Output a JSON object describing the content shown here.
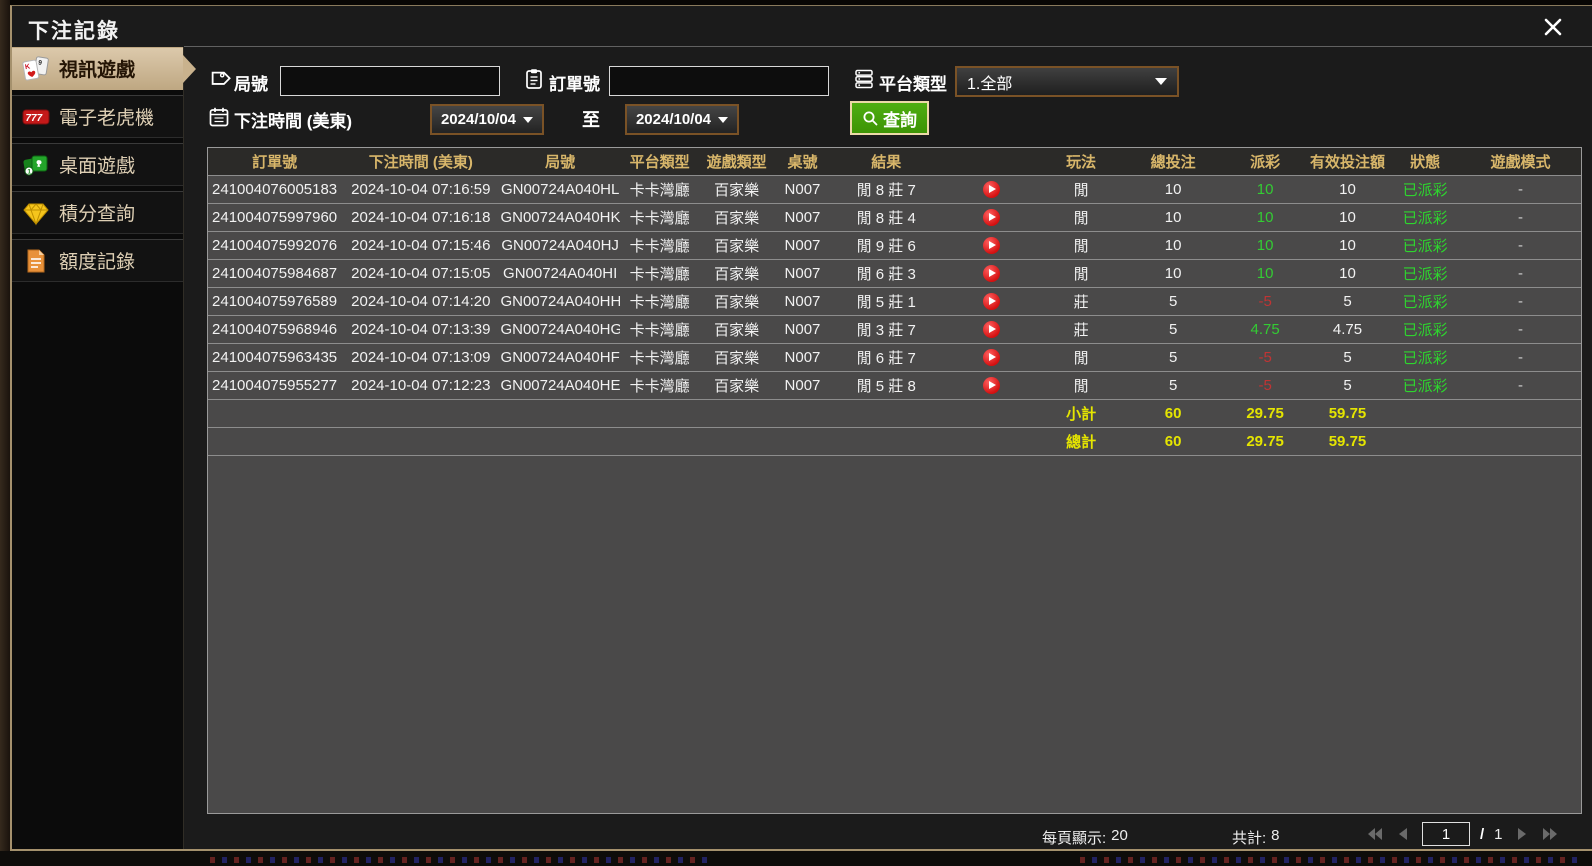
{
  "window": {
    "title": "下注記錄"
  },
  "sidebar": {
    "items": [
      {
        "label": "視訊遊戲",
        "active": true
      },
      {
        "label": "電子老虎機",
        "active": false
      },
      {
        "label": "桌面遊戲",
        "active": false
      },
      {
        "label": "積分查詢",
        "active": false
      },
      {
        "label": "額度記錄",
        "active": false
      }
    ]
  },
  "filters": {
    "round_label": "局號",
    "round_value": "",
    "order_label": "訂單號",
    "order_value": "",
    "platform_label": "平台類型",
    "platform_value": "1.全部",
    "time_label": "下注時間 (美東)",
    "date_from": "2024/10/04",
    "to_label": "至",
    "date_to": "2024/10/04",
    "search_label": "查詢"
  },
  "table": {
    "headers": [
      "訂單號",
      "下注時間 (美東)",
      "局號",
      "平台類型",
      "遊戲類型",
      "桌號",
      "結果",
      "",
      "玩法",
      "總投注",
      "派彩",
      "有效投注額",
      "狀態",
      "遊戲模式"
    ],
    "rows": [
      {
        "order_no": "241004076005183",
        "bet_time": "2024-10-04 07:16:59",
        "round_no": "GN00724A040HL",
        "platform": "卡卡灣廳",
        "game_type": "百家樂",
        "table_no": "N007",
        "result": "閒 8 莊 7",
        "play": "閒",
        "total_bet": "10",
        "payout": "10",
        "valid_bet": "10",
        "status": "已派彩",
        "mode": "-"
      },
      {
        "order_no": "241004075997960",
        "bet_time": "2024-10-04 07:16:18",
        "round_no": "GN00724A040HK",
        "platform": "卡卡灣廳",
        "game_type": "百家樂",
        "table_no": "N007",
        "result": "閒 8 莊 4",
        "play": "閒",
        "total_bet": "10",
        "payout": "10",
        "valid_bet": "10",
        "status": "已派彩",
        "mode": "-"
      },
      {
        "order_no": "241004075992076",
        "bet_time": "2024-10-04 07:15:46",
        "round_no": "GN00724A040HJ",
        "platform": "卡卡灣廳",
        "game_type": "百家樂",
        "table_no": "N007",
        "result": "閒 9 莊 6",
        "play": "閒",
        "total_bet": "10",
        "payout": "10",
        "valid_bet": "10",
        "status": "已派彩",
        "mode": "-"
      },
      {
        "order_no": "241004075984687",
        "bet_time": "2024-10-04 07:15:05",
        "round_no": "GN00724A040HI",
        "platform": "卡卡灣廳",
        "game_type": "百家樂",
        "table_no": "N007",
        "result": "閒 6 莊 3",
        "play": "閒",
        "total_bet": "10",
        "payout": "10",
        "valid_bet": "10",
        "status": "已派彩",
        "mode": "-"
      },
      {
        "order_no": "241004075976589",
        "bet_time": "2024-10-04 07:14:20",
        "round_no": "GN00724A040HH",
        "platform": "卡卡灣廳",
        "game_type": "百家樂",
        "table_no": "N007",
        "result": "閒 5 莊 1",
        "play": "莊",
        "total_bet": "5",
        "payout": "-5",
        "valid_bet": "5",
        "status": "已派彩",
        "mode": "-"
      },
      {
        "order_no": "241004075968946",
        "bet_time": "2024-10-04 07:13:39",
        "round_no": "GN00724A040HG",
        "platform": "卡卡灣廳",
        "game_type": "百家樂",
        "table_no": "N007",
        "result": "閒 3 莊 7",
        "play": "莊",
        "total_bet": "5",
        "payout": "4.75",
        "valid_bet": "4.75",
        "status": "已派彩",
        "mode": "-"
      },
      {
        "order_no": "241004075963435",
        "bet_time": "2024-10-04 07:13:09",
        "round_no": "GN00724A040HF",
        "platform": "卡卡灣廳",
        "game_type": "百家樂",
        "table_no": "N007",
        "result": "閒 6 莊 7",
        "play": "閒",
        "total_bet": "5",
        "payout": "-5",
        "valid_bet": "5",
        "status": "已派彩",
        "mode": "-"
      },
      {
        "order_no": "241004075955277",
        "bet_time": "2024-10-04 07:12:23",
        "round_no": "GN00724A040HE",
        "platform": "卡卡灣廳",
        "game_type": "百家樂",
        "table_no": "N007",
        "result": "閒 5 莊 8",
        "play": "閒",
        "total_bet": "5",
        "payout": "-5",
        "valid_bet": "5",
        "status": "已派彩",
        "mode": "-"
      }
    ],
    "subtotal": {
      "label": "小計",
      "total_bet": "60",
      "payout": "29.75",
      "valid_bet": "59.75"
    },
    "grand_total": {
      "label": "總計",
      "total_bet": "60",
      "payout": "29.75",
      "valid_bet": "59.75"
    }
  },
  "pagination": {
    "per_page_label": "每頁顯示:",
    "per_page_value": "20",
    "total_label": "共計:",
    "total_value": "8",
    "page_value": "1",
    "page_separator": "/",
    "total_pages": "1"
  },
  "colors": {
    "payout_positive": "#33cc33",
    "payout_negative": "#c03434",
    "status_paid": "#2ed52e",
    "totals_yellow": "#e5e500",
    "header_gold": "#d8b66a",
    "accent_tan": "#c9b28d",
    "date_border_brown": "#7a5226",
    "search_button_green": "#44a30a",
    "play_button_red": "#d40f0f"
  }
}
